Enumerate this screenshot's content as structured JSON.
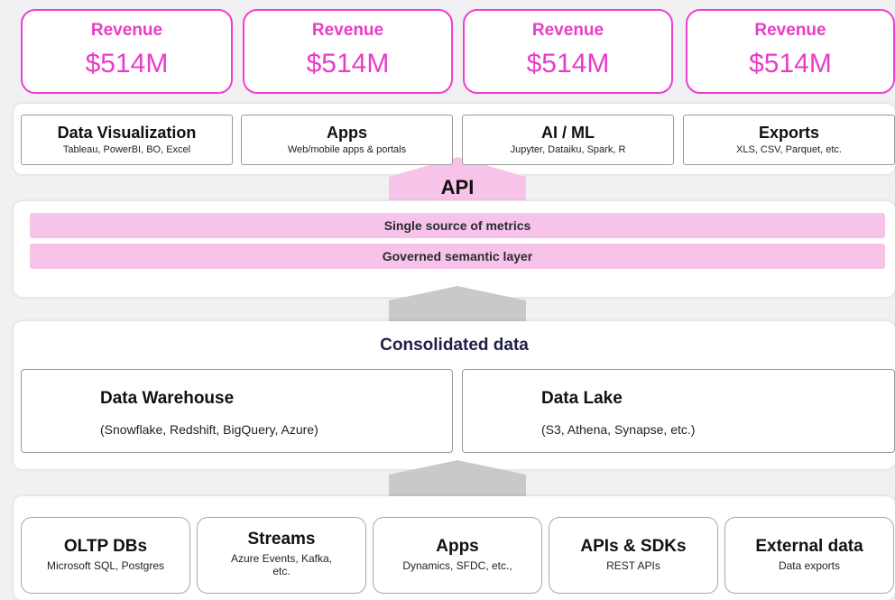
{
  "revenue_cards": [
    {
      "title": "Revenue",
      "value": "$514M"
    },
    {
      "title": "Revenue",
      "value": "$514M"
    },
    {
      "title": "Revenue",
      "value": "$514M"
    },
    {
      "title": "Revenue",
      "value": "$514M"
    }
  ],
  "consumers": [
    {
      "title": "Data Visualization",
      "subtitle": "Tableau, PowerBI, BO, Excel"
    },
    {
      "title": "Apps",
      "subtitle": "Web/mobile apps & portals"
    },
    {
      "title": "AI / ML",
      "subtitle": "Jupyter, Dataiku, Spark, R"
    },
    {
      "title": "Exports",
      "subtitle": "XLS, CSV, Parquet, etc."
    }
  ],
  "api_label": "API",
  "semantic_layer": {
    "bar1": "Single source of metrics",
    "bar2": "Governed semantic layer"
  },
  "consolidated": {
    "heading": "Consolidated data",
    "stores": [
      {
        "title": "Data Warehouse",
        "subtitle": "(Snowflake, Redshift, BigQuery, Azure)"
      },
      {
        "title": "Data Lake",
        "subtitle": "(S3, Athena, Synapse, etc.)"
      }
    ]
  },
  "sources": [
    {
      "title": "OLTP DBs",
      "subtitle": "Microsoft SQL, Postgres"
    },
    {
      "title": "Streams",
      "subtitle": "Azure Events, Kafka, etc."
    },
    {
      "title": "Apps",
      "subtitle": "Dynamics, SFDC, etc.,"
    },
    {
      "title": "APIs & SDKs",
      "subtitle": "REST APIs"
    },
    {
      "title": "External data",
      "subtitle": "Data exports"
    }
  ],
  "colors": {
    "accent": "#e93cc8",
    "band": "#f8c3e8",
    "arrow": "#c9c9c9"
  }
}
